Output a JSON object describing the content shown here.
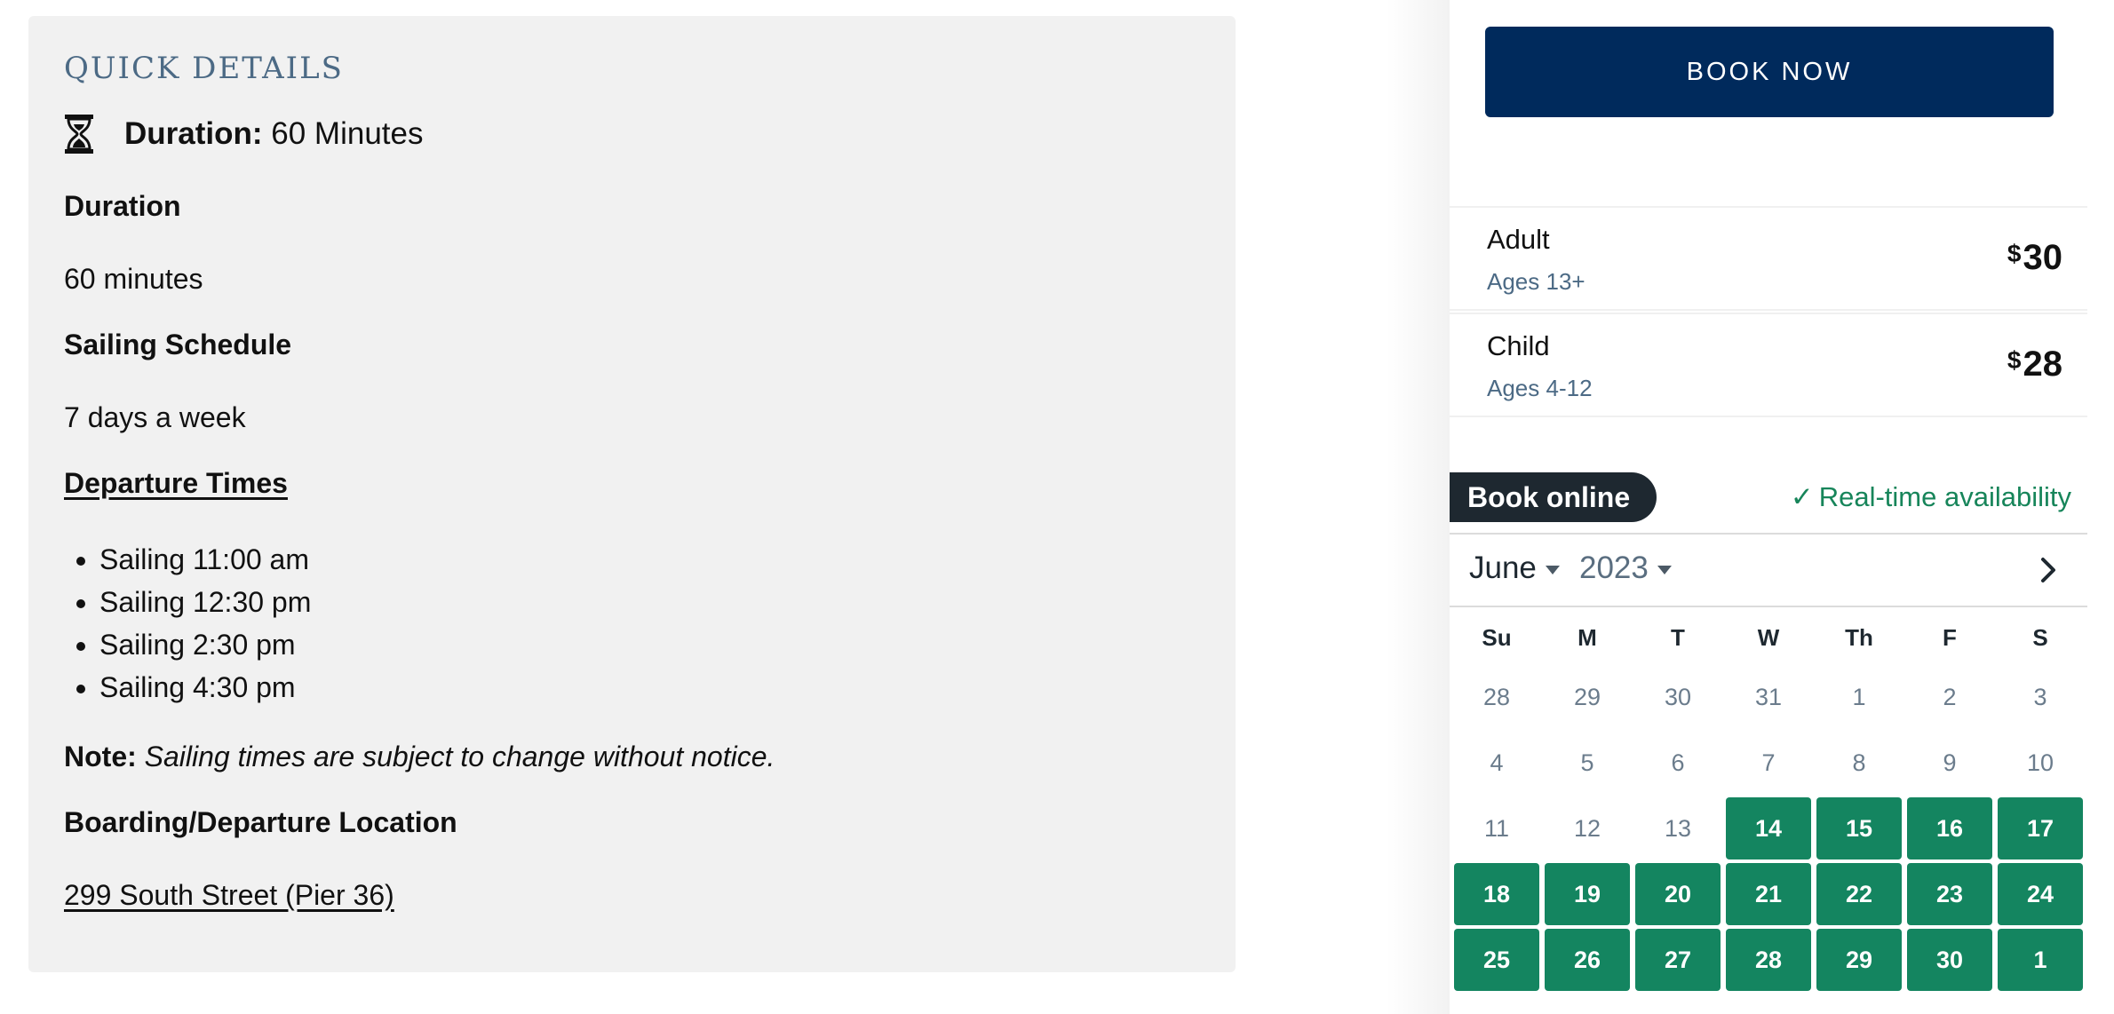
{
  "details": {
    "title": "QUICK DETAILS",
    "duration_label": "Duration:",
    "duration_value": "60 Minutes",
    "sections": {
      "duration_heading": "Duration",
      "duration_text": "60 minutes",
      "schedule_heading": "Sailing Schedule",
      "schedule_text": "7 days a week",
      "departure_heading": "Departure Times",
      "times": [
        "Sailing 11:00 am",
        "Sailing 12:30 pm",
        "Sailing 2:30 pm",
        "Sailing 4:30 pm"
      ],
      "note_label": "Note:",
      "note_text": "Sailing times are subject to change without notice.",
      "location_heading": "Boarding/Departure Location",
      "location_address": "299 South Street (Pier 36)"
    }
  },
  "booking": {
    "book_now_label": "BOOK NOW",
    "prices": [
      {
        "name": "Adult",
        "ages": "Ages 13+",
        "currency": "$",
        "amount": "30"
      },
      {
        "name": "Child",
        "ages": "Ages 4-12",
        "currency": "$",
        "amount": "28"
      }
    ],
    "book_online_label": "Book online",
    "realtime_label": "Real-time availability",
    "accent_color": "#148560",
    "primary_color": "#002a5c"
  },
  "calendar": {
    "month": "June",
    "year": "2023",
    "weekdays": [
      "Su",
      "M",
      "T",
      "W",
      "Th",
      "F",
      "S"
    ],
    "days": [
      {
        "d": "28",
        "available": false
      },
      {
        "d": "29",
        "available": false
      },
      {
        "d": "30",
        "available": false
      },
      {
        "d": "31",
        "available": false
      },
      {
        "d": "1",
        "available": false
      },
      {
        "d": "2",
        "available": false
      },
      {
        "d": "3",
        "available": false
      },
      {
        "d": "4",
        "available": false
      },
      {
        "d": "5",
        "available": false
      },
      {
        "d": "6",
        "available": false
      },
      {
        "d": "7",
        "available": false
      },
      {
        "d": "8",
        "available": false
      },
      {
        "d": "9",
        "available": false
      },
      {
        "d": "10",
        "available": false
      },
      {
        "d": "11",
        "available": false
      },
      {
        "d": "12",
        "available": false
      },
      {
        "d": "13",
        "available": false
      },
      {
        "d": "14",
        "available": true
      },
      {
        "d": "15",
        "available": true
      },
      {
        "d": "16",
        "available": true
      },
      {
        "d": "17",
        "available": true
      },
      {
        "d": "18",
        "available": true
      },
      {
        "d": "19",
        "available": true
      },
      {
        "d": "20",
        "available": true
      },
      {
        "d": "21",
        "available": true
      },
      {
        "d": "22",
        "available": true
      },
      {
        "d": "23",
        "available": true
      },
      {
        "d": "24",
        "available": true
      },
      {
        "d": "25",
        "available": true
      },
      {
        "d": "26",
        "available": true
      },
      {
        "d": "27",
        "available": true
      },
      {
        "d": "28",
        "available": true
      },
      {
        "d": "29",
        "available": true
      },
      {
        "d": "30",
        "available": true
      },
      {
        "d": "1",
        "available": true
      }
    ]
  }
}
